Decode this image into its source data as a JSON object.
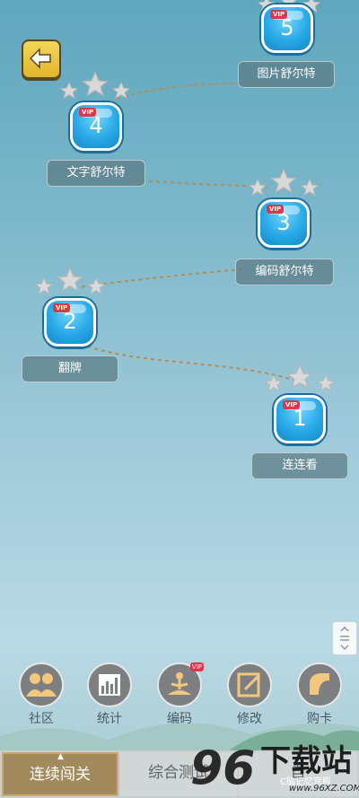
{
  "nav": {
    "back_icon": "arrow-left-icon"
  },
  "levels": [
    {
      "number": "1",
      "label": "连连看",
      "vip": "VIP"
    },
    {
      "number": "2",
      "label": "翻牌",
      "vip": "VIP"
    },
    {
      "number": "3",
      "label": "编码舒尔特",
      "vip": "VIP"
    },
    {
      "number": "4",
      "label": "文字舒尔特",
      "vip": "VIP"
    },
    {
      "number": "5",
      "label": "图片舒尔特",
      "vip": "VIP"
    }
  ],
  "bottom_nav": [
    {
      "label": "社区",
      "icon": "people-icon"
    },
    {
      "label": "统计",
      "icon": "bar-chart-icon"
    },
    {
      "label": "编码",
      "icon": "meditation-icon",
      "vip": "VIP"
    },
    {
      "label": "修改",
      "icon": "edit-icon"
    },
    {
      "label": "购卡",
      "icon": "card-icon"
    }
  ],
  "tabs": [
    {
      "label": "连续闯关",
      "active": true
    },
    {
      "label": "综合测试",
      "active": false
    },
    {
      "label": "自",
      "active": false
    }
  ],
  "watermark": {
    "digits": "96",
    "text": "下载站",
    "url": "www.96XZ.COM",
    "small": "C脑记忆宫殿"
  },
  "colors": {
    "accent_blue": "#27a9e6",
    "vip_red": "#e0364a",
    "active_tab": "#a38a5d",
    "back_yellow": "#f4d659"
  }
}
